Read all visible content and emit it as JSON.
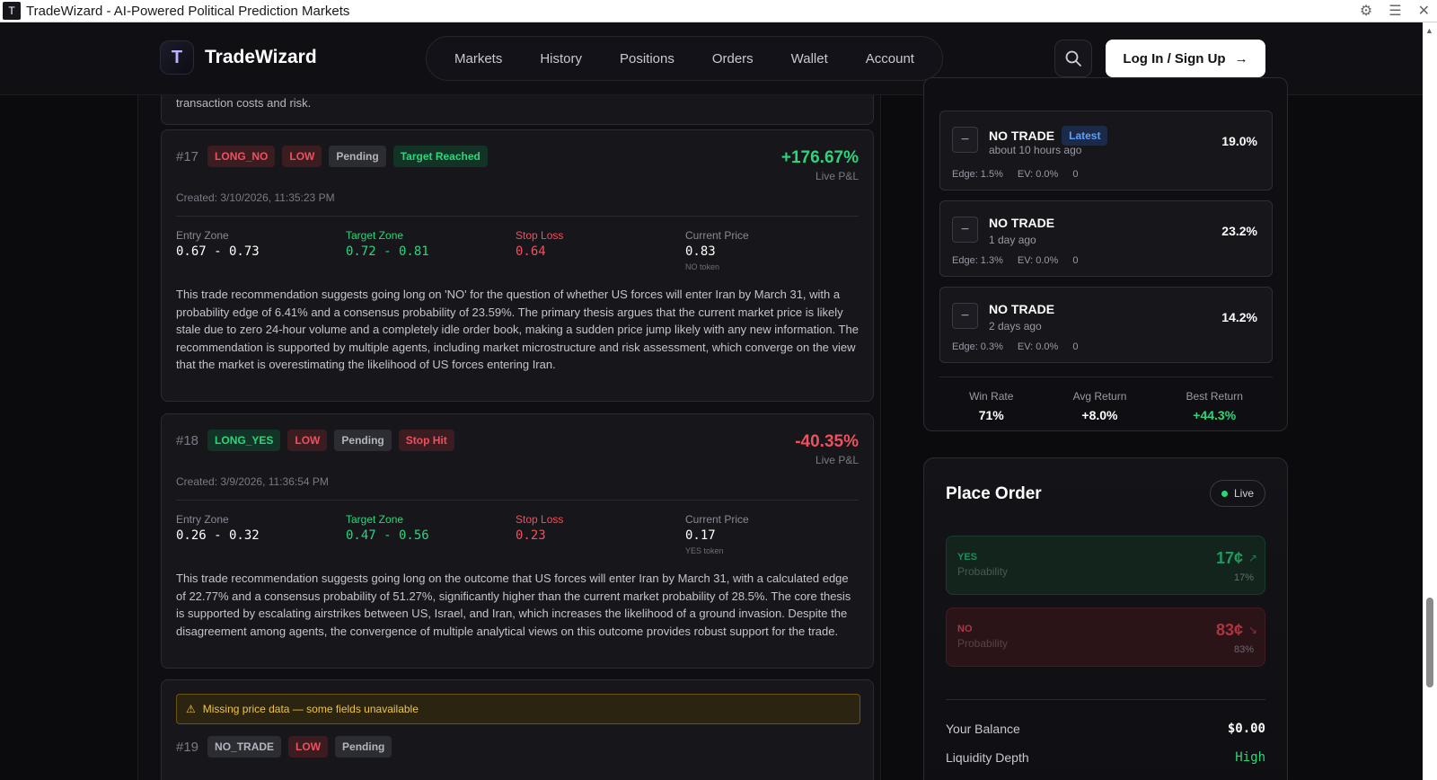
{
  "browser": {
    "title": "TradeWizard - AI-Powered Political Prediction Markets",
    "favicon_letter": "T"
  },
  "header": {
    "logo_letter": "T",
    "brand": "TradeWizard",
    "nav": [
      "Markets",
      "History",
      "Positions",
      "Orders",
      "Wallet",
      "Account"
    ],
    "login_label": "Log In / Sign Up"
  },
  "snippet": {
    "text": "transaction costs and risk."
  },
  "recommendations": [
    {
      "num": "#17",
      "badges": [
        "LONG_NO",
        "LOW",
        "Pending",
        "Target Reached"
      ],
      "pnl": "+176.67%",
      "pnl_label": "Live P&L",
      "created": "Created: 3/10/2026, 11:35:23 PM",
      "entry_label": "Entry Zone",
      "entry": "0.67 - 0.73",
      "target_label": "Target Zone",
      "target": "0.72 - 0.81",
      "stop_label": "Stop Loss",
      "stop": "0.64",
      "price_label": "Current Price",
      "price": "0.83",
      "token": "NO token",
      "description": "This trade recommendation suggests going long on 'NO' for the question of whether US forces will enter Iran by March 31, with a probability edge of 6.41% and a consensus probability of 23.59%. The primary thesis argues that the current market price is likely stale due to zero 24-hour volume and a completely idle order book, making a sudden price jump likely with any new information. The recommendation is supported by multiple agents, including market microstructure and risk assessment, which converge on the view that the market is overestimating the likelihood of US forces entering Iran."
    },
    {
      "num": "#18",
      "badges": [
        "LONG_YES",
        "LOW",
        "Pending",
        "Stop Hit"
      ],
      "pnl": "-40.35%",
      "pnl_label": "Live P&L",
      "created": "Created: 3/9/2026, 11:36:54 PM",
      "entry_label": "Entry Zone",
      "entry": "0.26 - 0.32",
      "target_label": "Target Zone",
      "target": "0.47 - 0.56",
      "stop_label": "Stop Loss",
      "stop": "0.23",
      "price_label": "Current Price",
      "price": "0.17",
      "token": "YES token",
      "description": "This trade recommendation suggests going long on the outcome that US forces will enter Iran by March 31, with a calculated edge of 22.77% and a consensus probability of 51.27%, significantly higher than the current market probability of 28.5%. The core thesis is supported by escalating airstrikes between US, Israel, and Iran, which increases the likelihood of a ground invasion. Despite the disagreement among agents, the convergence of multiple analytical views on this outcome provides robust support for the trade."
    }
  ],
  "rec19": {
    "warning": "Missing price data — some fields unavailable",
    "num": "#19",
    "badges": [
      "NO_TRADE",
      "LOW",
      "Pending"
    ]
  },
  "history": {
    "items": [
      {
        "title": "NO TRADE",
        "latest": "Latest",
        "time": "about 10 hours ago",
        "pct": "19.0%",
        "edge": "Edge: 1.5%",
        "ev": "EV: 0.0%",
        "count": "0"
      },
      {
        "title": "NO TRADE",
        "latest": "",
        "time": "1 day ago",
        "pct": "23.2%",
        "edge": "Edge: 1.3%",
        "ev": "EV: 0.0%",
        "count": "0"
      },
      {
        "title": "NO TRADE",
        "latest": "",
        "time": "2 days ago",
        "pct": "14.2%",
        "edge": "Edge: 0.3%",
        "ev": "EV: 0.0%",
        "count": "0"
      }
    ],
    "stats": {
      "win_rate_label": "Win Rate",
      "win_rate": "71%",
      "avg_return_label": "Avg Return",
      "avg_return": "+8.0%",
      "best_return_label": "Best Return",
      "best_return": "+44.3%"
    }
  },
  "order": {
    "title": "Place Order",
    "live": "Live",
    "yes": {
      "key": "YES",
      "label": "Probability",
      "price": "17¢",
      "pct": "17%"
    },
    "no": {
      "key": "NO",
      "label": "Probability",
      "price": "83¢",
      "pct": "83%"
    },
    "balance_label": "Your Balance",
    "balance": "$0.00",
    "liquidity_label": "Liquidity Depth",
    "liquidity": "High"
  },
  "colors": {
    "positive": "#2bd67b",
    "negative": "#f0505e",
    "warning": "#f2c53d",
    "accent": "#5aa0ff"
  }
}
